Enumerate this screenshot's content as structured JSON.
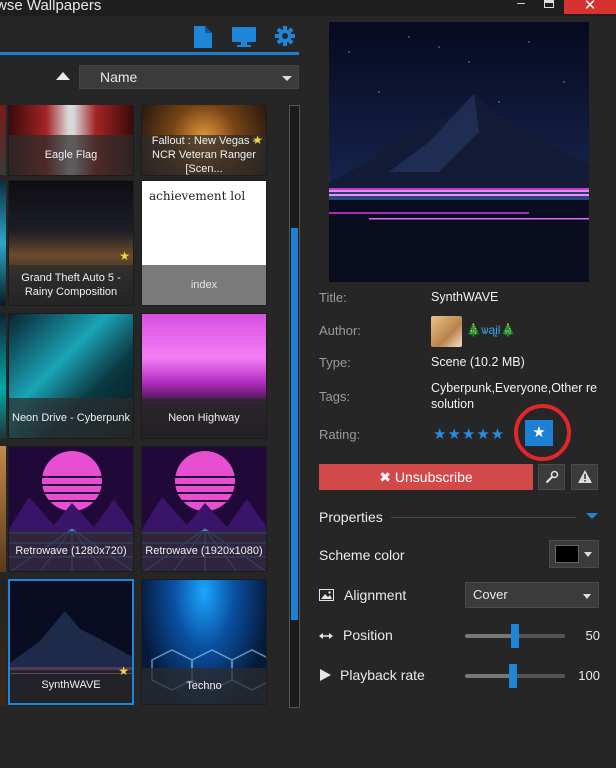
{
  "window": {
    "title": "wse Wallpapers",
    "minimize": "–",
    "close": "✕"
  },
  "toolbar": {
    "icons": [
      "file-icon",
      "monitor-icon",
      "gear-icon"
    ],
    "accent": "#1a7fd0"
  },
  "sort": {
    "direction": "ascending",
    "selected": "Name"
  },
  "grid": {
    "tiles": [
      {
        "label": "Eagle Flag",
        "favorite": false,
        "selected": false
      },
      {
        "label": "Fallout : New Vegas - NCR Veteran Ranger [Scen...",
        "favorite": true,
        "selected": false
      },
      {
        "label": "Grand Theft Auto 5 - Rainy Composition",
        "favorite": true,
        "selected": false
      },
      {
        "label": "index",
        "favorite": false,
        "selected": false,
        "preview_text": "achievement lol"
      },
      {
        "label": "Neon Drive - Cyberpunk",
        "favorite": false,
        "selected": false
      },
      {
        "label": "Neon Highway",
        "favorite": false,
        "selected": false
      },
      {
        "label": "Retrowave (1280x720)",
        "favorite": false,
        "selected": false
      },
      {
        "label": "Retrowave (1920x1080)",
        "favorite": false,
        "selected": false
      },
      {
        "label": "SynthWAVE",
        "favorite": true,
        "selected": true
      },
      {
        "label": "Techno",
        "favorite": false,
        "selected": false
      }
    ],
    "scroll_position_fraction": 0.25
  },
  "details": {
    "title_label": "Title:",
    "title_value": "SynthWAVE",
    "author_label": "Author:",
    "author_value": "ѡąįl",
    "author_decor": "🎄",
    "type_label": "Type:",
    "type_value": "Scene (10.2 MB)",
    "tags_label": "Tags:",
    "tags_line1": "Cyberpunk,Everyone,Other re",
    "tags_line2": "solution",
    "rating_label": "Rating:",
    "rating_stars": 5,
    "rating_glyphs": "★★★★★",
    "favorite_glyph": "★"
  },
  "actions": {
    "unsubscribe_label": "✖ Unsubscribe",
    "unsubscribe_color": "#d14949",
    "steam_icon": "steam-icon",
    "report_icon": "warning-icon"
  },
  "properties": {
    "header": "Properties",
    "scheme_color_label": "Scheme color",
    "scheme_color_value": "#000000",
    "alignment_label": "Alignment",
    "alignment_value": "Cover",
    "position_label": "Position",
    "position_value": "50",
    "playback_label": "Playback rate",
    "playback_value": "100"
  }
}
